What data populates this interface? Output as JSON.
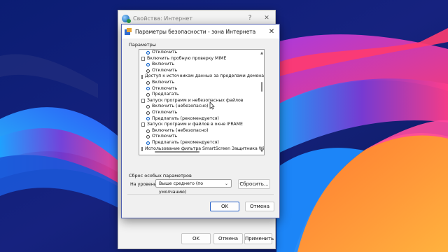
{
  "back_window": {
    "title": "Свойства: Интернет",
    "help_label": "?",
    "close_label": "✕",
    "buttons": {
      "ok": "OK",
      "cancel": "Отмена",
      "apply": "Применить"
    }
  },
  "dialog": {
    "title": "Параметры безопасности - зона Интернета",
    "close_label": "✕",
    "params_label": "Параметры",
    "settings": [
      {
        "kind": "option",
        "label": "Отключить",
        "selected": true
      },
      {
        "kind": "header",
        "label": "Включить пробную проверку MIME"
      },
      {
        "kind": "option",
        "label": "Включить",
        "selected": true
      },
      {
        "kind": "option",
        "label": "Отключить",
        "selected": false
      },
      {
        "kind": "header",
        "label": "Доступ к источникам данных за пределами домена"
      },
      {
        "kind": "option",
        "label": "Включить",
        "selected": false
      },
      {
        "kind": "option",
        "label": "Отключить",
        "selected": true
      },
      {
        "kind": "option",
        "label": "Предлагать",
        "selected": false
      },
      {
        "kind": "header",
        "label": "Запуск программ и небезопасных файлов"
      },
      {
        "kind": "option",
        "label": "Включить (небезопасно)",
        "selected": false
      },
      {
        "kind": "option",
        "label": "Отключить",
        "selected": false
      },
      {
        "kind": "option",
        "label": "Предлагать (рекомендуется)",
        "selected": true
      },
      {
        "kind": "header",
        "label": "Запуск программ и файлов в окне IFRAME"
      },
      {
        "kind": "option",
        "label": "Включить (небезопасно)",
        "selected": false
      },
      {
        "kind": "option",
        "label": "Отключить",
        "selected": false
      },
      {
        "kind": "option",
        "label": "Предлагать (рекомендуется)",
        "selected": true
      },
      {
        "kind": "header",
        "label": "Использование фильтра SmartScreen Защитника Windows"
      }
    ],
    "reset": {
      "section_label": "Сброс особых параметров",
      "level_label": "На уровень:",
      "level_value": "Выше среднего (по умолчанию)",
      "reset_button": "Сбросить..."
    },
    "buttons": {
      "ok": "OK",
      "cancel": "Отмена"
    }
  },
  "colors": {
    "desktop_bg": "#0e1f6e",
    "dialog_border": "#4f60b0",
    "radio_selected": "#0a5fc8",
    "default_button_border": "#2b64c9"
  }
}
